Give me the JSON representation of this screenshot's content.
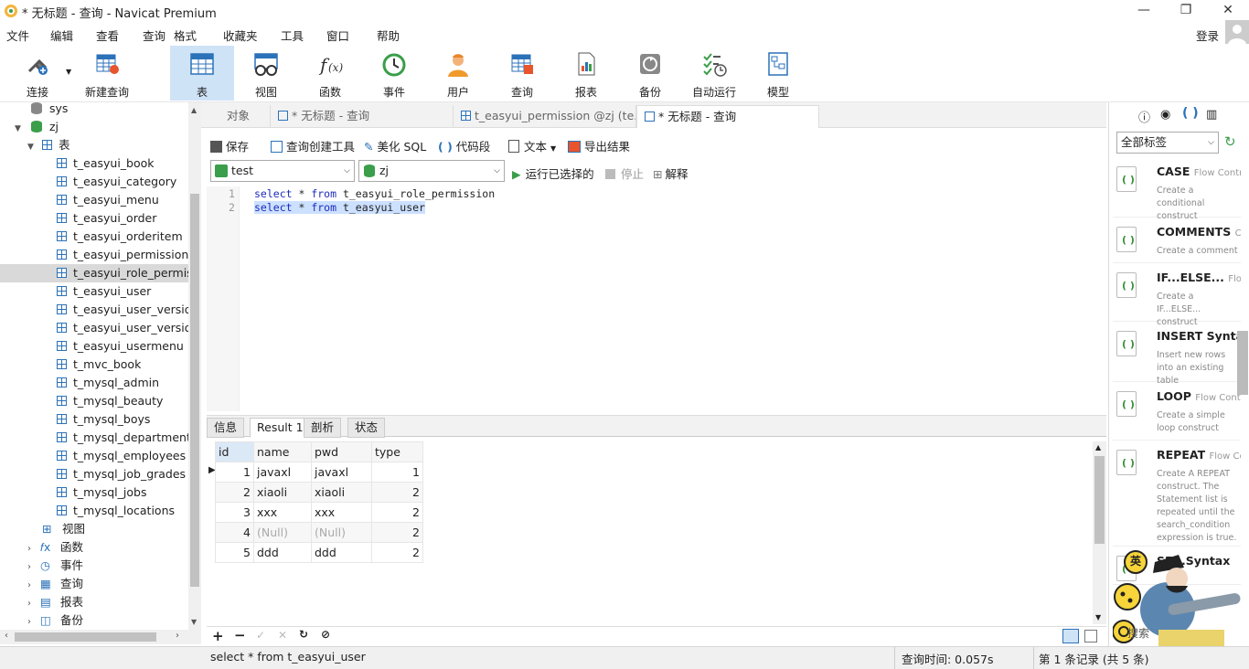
{
  "window": {
    "title": "* 无标题 - 查询 - Navicat Premium",
    "login": "登录"
  },
  "menu": [
    "文件",
    "编辑",
    "查看",
    "查询",
    "格式",
    "收藏夹",
    "工具",
    "窗口",
    "帮助"
  ],
  "toolbar": {
    "connect": "连接",
    "new_query": "新建查询",
    "buttons": [
      "表",
      "视图",
      "函数",
      "事件",
      "用户",
      "查询",
      "报表",
      "备份",
      "自动运行",
      "模型"
    ]
  },
  "tree": {
    "sys": "sys",
    "db": "zj",
    "tables_node": "表",
    "tables": [
      "t_easyui_book",
      "t_easyui_category",
      "t_easyui_menu",
      "t_easyui_order",
      "t_easyui_orderitem",
      "t_easyui_permission",
      "t_easyui_role_permiss",
      "t_easyui_user",
      "t_easyui_user_version",
      "t_easyui_user_version",
      "t_easyui_usermenu",
      "t_mvc_book",
      "t_mysql_admin",
      "t_mysql_beauty",
      "t_mysql_boys",
      "t_mysql_departments",
      "t_mysql_employees",
      "t_mysql_job_grades",
      "t_mysql_jobs",
      "t_mysql_locations"
    ],
    "others": [
      "视图",
      "函数",
      "事件",
      "查询",
      "报表",
      "备份"
    ]
  },
  "tabs": [
    "对象",
    "* 无标题 - 查询",
    "t_easyui_permission @zj (te...",
    "* 无标题 - 查询"
  ],
  "query_toolbar": {
    "save": "保存",
    "builder": "查询创建工具",
    "beautify": "美化 SQL",
    "snippet": "代码段",
    "text": "文本",
    "export": "导出结果"
  },
  "run_bar": {
    "connection": "test",
    "database": "zj",
    "run": "运行已选择的",
    "stop": "停止",
    "explain": "解释"
  },
  "editor": {
    "lines": [
      {
        "no": "1",
        "kw1": "select",
        "star": " * ",
        "kw2": "from",
        "tbl": " t_easyui_role_permission"
      },
      {
        "no": "2",
        "kw1": "select",
        "star": " * ",
        "kw2": "from",
        "tbl": " t_easyui_user"
      }
    ]
  },
  "result_tabs": [
    "信息",
    "Result 1",
    "剖析",
    "状态"
  ],
  "grid": {
    "columns": [
      "id",
      "name",
      "pwd",
      "type"
    ],
    "rows": [
      [
        "1",
        "javaxl",
        "javaxl",
        "1"
      ],
      [
        "2",
        "xiaoli",
        "xiaoli",
        "2"
      ],
      [
        "3",
        "xxx",
        "xxx",
        "2"
      ],
      [
        "4",
        "(Null)",
        "(Null)",
        "2"
      ],
      [
        "5",
        "ddd",
        "ddd",
        "2"
      ]
    ]
  },
  "status": {
    "sql": "select * from t_easyui_user",
    "time": "查询时间: 0.057s",
    "records": "第 1 条记录 (共 5 条)"
  },
  "snippets": {
    "filter": "全部标签",
    "items": [
      {
        "title": "CASE",
        "cat": "Flow Control",
        "desc": "Create a conditional construct"
      },
      {
        "title": "COMMENTS",
        "cat": "Co",
        "desc": "Create a comment"
      },
      {
        "title": "IF...ELSE...",
        "cat": "Flow C",
        "desc": "Create a IF...ELSE... construct"
      },
      {
        "title": "INSERT Syntax",
        "cat": "",
        "desc": "Insert new rows into an existing table"
      },
      {
        "title": "LOOP",
        "cat": "Flow Control",
        "desc": "Create a simple loop construct"
      },
      {
        "title": "REPEAT",
        "cat": "Flow Co",
        "desc": "Create A REPEAT construct. The Statement list is repeated until the search_condition expression is true."
      },
      {
        "title": "SE...Syntax",
        "cat": "",
        "desc": ""
      }
    ],
    "search": "搜索",
    "ime": "英"
  },
  "colors": {
    "accent": "#2b72b9",
    "active_tab": "#cfe3f7",
    "keyword": "#1c2bbd",
    "selection": "#cce0ff"
  }
}
